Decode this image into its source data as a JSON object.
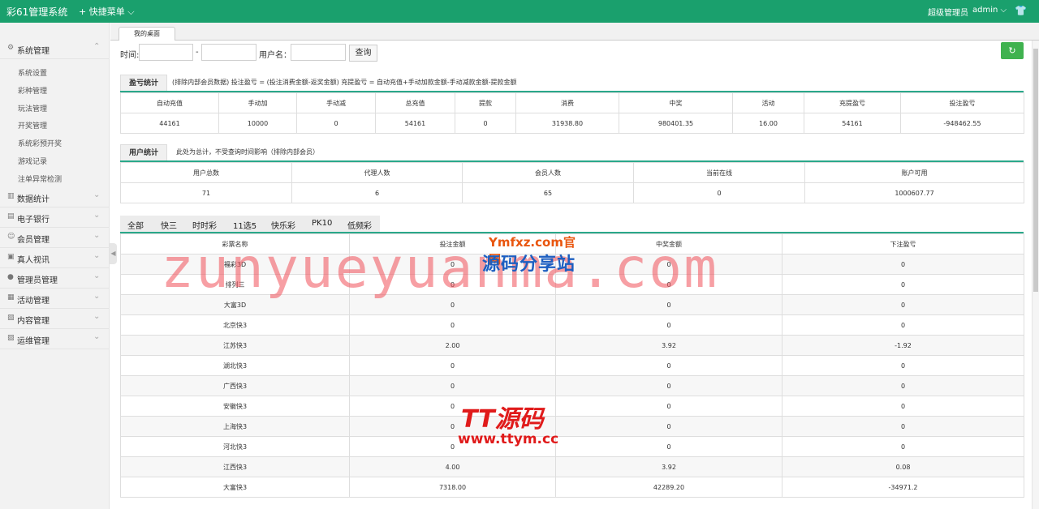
{
  "topbar": {
    "app_title": "彩61管理系统",
    "quick_menu": "快捷菜单",
    "role": "超级管理员",
    "username": "admin"
  },
  "sidebar": {
    "groups": [
      {
        "label": "系统管理",
        "icon": "gear-icon",
        "items": [
          "系统设置",
          "彩种管理",
          "玩法管理",
          "开奖管理",
          "系统彩预开奖",
          "游戏记录",
          "注单异常检测"
        ]
      },
      {
        "label": "数据统计",
        "icon": "chart-icon"
      },
      {
        "label": "电子银行",
        "icon": "bank-icon"
      },
      {
        "label": "会员管理",
        "icon": "users-icon"
      },
      {
        "label": "真人视讯",
        "icon": "video-icon"
      },
      {
        "label": "管理员管理",
        "icon": "admin-icon"
      },
      {
        "label": "活动管理",
        "icon": "activity-icon"
      },
      {
        "label": "内容管理",
        "icon": "content-icon"
      },
      {
        "label": "运维管理",
        "icon": "ops-icon"
      }
    ]
  },
  "tabs": [
    "我的桌面"
  ],
  "filter": {
    "time_label": "时间:",
    "range_sep": "-",
    "username_label": "用户名：",
    "start_value": "",
    "end_value": "",
    "username_value": "",
    "query_button": "查询"
  },
  "profit": {
    "title": "盈亏统计",
    "note": "(排除内部会员数据)  投注盈亏 = (投注消费金额-返奖金额)     充提盈亏 = 自动充值+手动加款金额-手动减款金额-提款金额",
    "headers": [
      "自动充值",
      "手动加",
      "手动减",
      "总充值",
      "提款",
      "消费",
      "中奖",
      "活动",
      "充提盈亏",
      "投注盈亏"
    ],
    "values": [
      "44161",
      "10000",
      "0",
      "54161",
      "0",
      "31938.80",
      "980401.35",
      "16.00",
      "54161",
      "-948462.55"
    ]
  },
  "users": {
    "title": "用户统计",
    "note": "此处为总计，不受查询时间影响（排除内部会员）",
    "headers": [
      "用户总数",
      "代理人数",
      "会员人数",
      "当前在线",
      "账户可用"
    ],
    "values": [
      "71",
      "6",
      "65",
      "0",
      "1000607.77"
    ]
  },
  "lottery": {
    "categories": [
      "全部",
      "快三",
      "时时彩",
      "11选5",
      "快乐彩",
      "PK10",
      "低频彩"
    ],
    "headers": [
      "彩票名称",
      "投注金额",
      "中奖金额",
      "下注盈亏"
    ],
    "rows": [
      [
        "福彩3D",
        "0",
        "0",
        "0"
      ],
      [
        "排列三",
        "0",
        "0",
        "0"
      ],
      [
        "大富3D",
        "0",
        "0",
        "0"
      ],
      [
        "北京快3",
        "0",
        "0",
        "0"
      ],
      [
        "江苏快3",
        "2.00",
        "3.92",
        "-1.92"
      ],
      [
        "湖北快3",
        "0",
        "0",
        "0"
      ],
      [
        "广西快3",
        "0",
        "0",
        "0"
      ],
      [
        "安徽快3",
        "0",
        "0",
        "0"
      ],
      [
        "上海快3",
        "0",
        "0",
        "0"
      ],
      [
        "河北快3",
        "0",
        "0",
        "0"
      ],
      [
        "江西快3",
        "4.00",
        "3.92",
        "0.08"
      ],
      [
        "大富快3",
        "7318.00",
        "42289.20",
        "-34971.2"
      ]
    ]
  },
  "watermarks": {
    "big": "zunyueyuanma.com",
    "logo1_top": "Ymfxz.com官网",
    "logo1_bottom": "源码分享站",
    "logo2_top": "TT源码",
    "logo2_bottom": "www.ttym.cc"
  },
  "colors": {
    "topbar": "#1aa06d",
    "accent_line": "#2aa88a",
    "refresh_button": "#3fb24f"
  }
}
